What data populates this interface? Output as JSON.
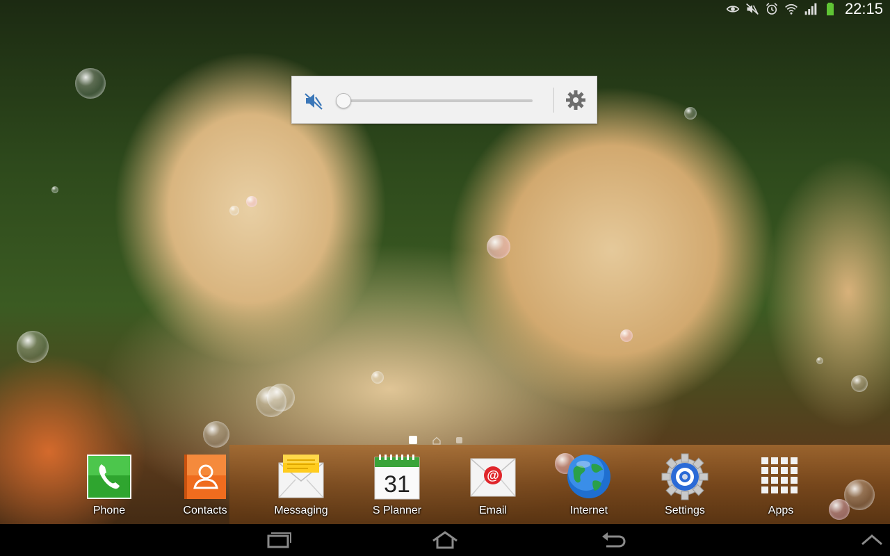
{
  "status_bar": {
    "time": "22:15",
    "icons": [
      "smart-stay-eye-icon",
      "mute-icon",
      "alarm-icon",
      "wifi-icon",
      "signal-icon",
      "battery-icon"
    ]
  },
  "volume_panel": {
    "level": 0,
    "muted": true,
    "icons": [
      "volume-mute-icon",
      "settings-gear-icon"
    ]
  },
  "home": {
    "pages": 3,
    "active_page": 1
  },
  "dock": {
    "apps": [
      {
        "label": "Phone",
        "icon": "phone-icon"
      },
      {
        "label": "Contacts",
        "icon": "contacts-icon"
      },
      {
        "label": "Messaging",
        "icon": "messaging-icon"
      },
      {
        "label": "S Planner",
        "icon": "calendar-icon",
        "day": "31"
      },
      {
        "label": "Email",
        "icon": "email-icon"
      },
      {
        "label": "Internet",
        "icon": "globe-icon"
      },
      {
        "label": "Settings",
        "icon": "settings-icon"
      },
      {
        "label": "Apps",
        "icon": "app-grid-icon"
      }
    ]
  },
  "nav_bar": {
    "buttons": [
      "recent-apps-icon",
      "home-icon",
      "back-icon",
      "up-chevron-icon"
    ]
  },
  "colors": {
    "volume_panel_bg": "#f1f1f1",
    "mute_icon": "#3b77b8",
    "battery": "#5fc434"
  }
}
